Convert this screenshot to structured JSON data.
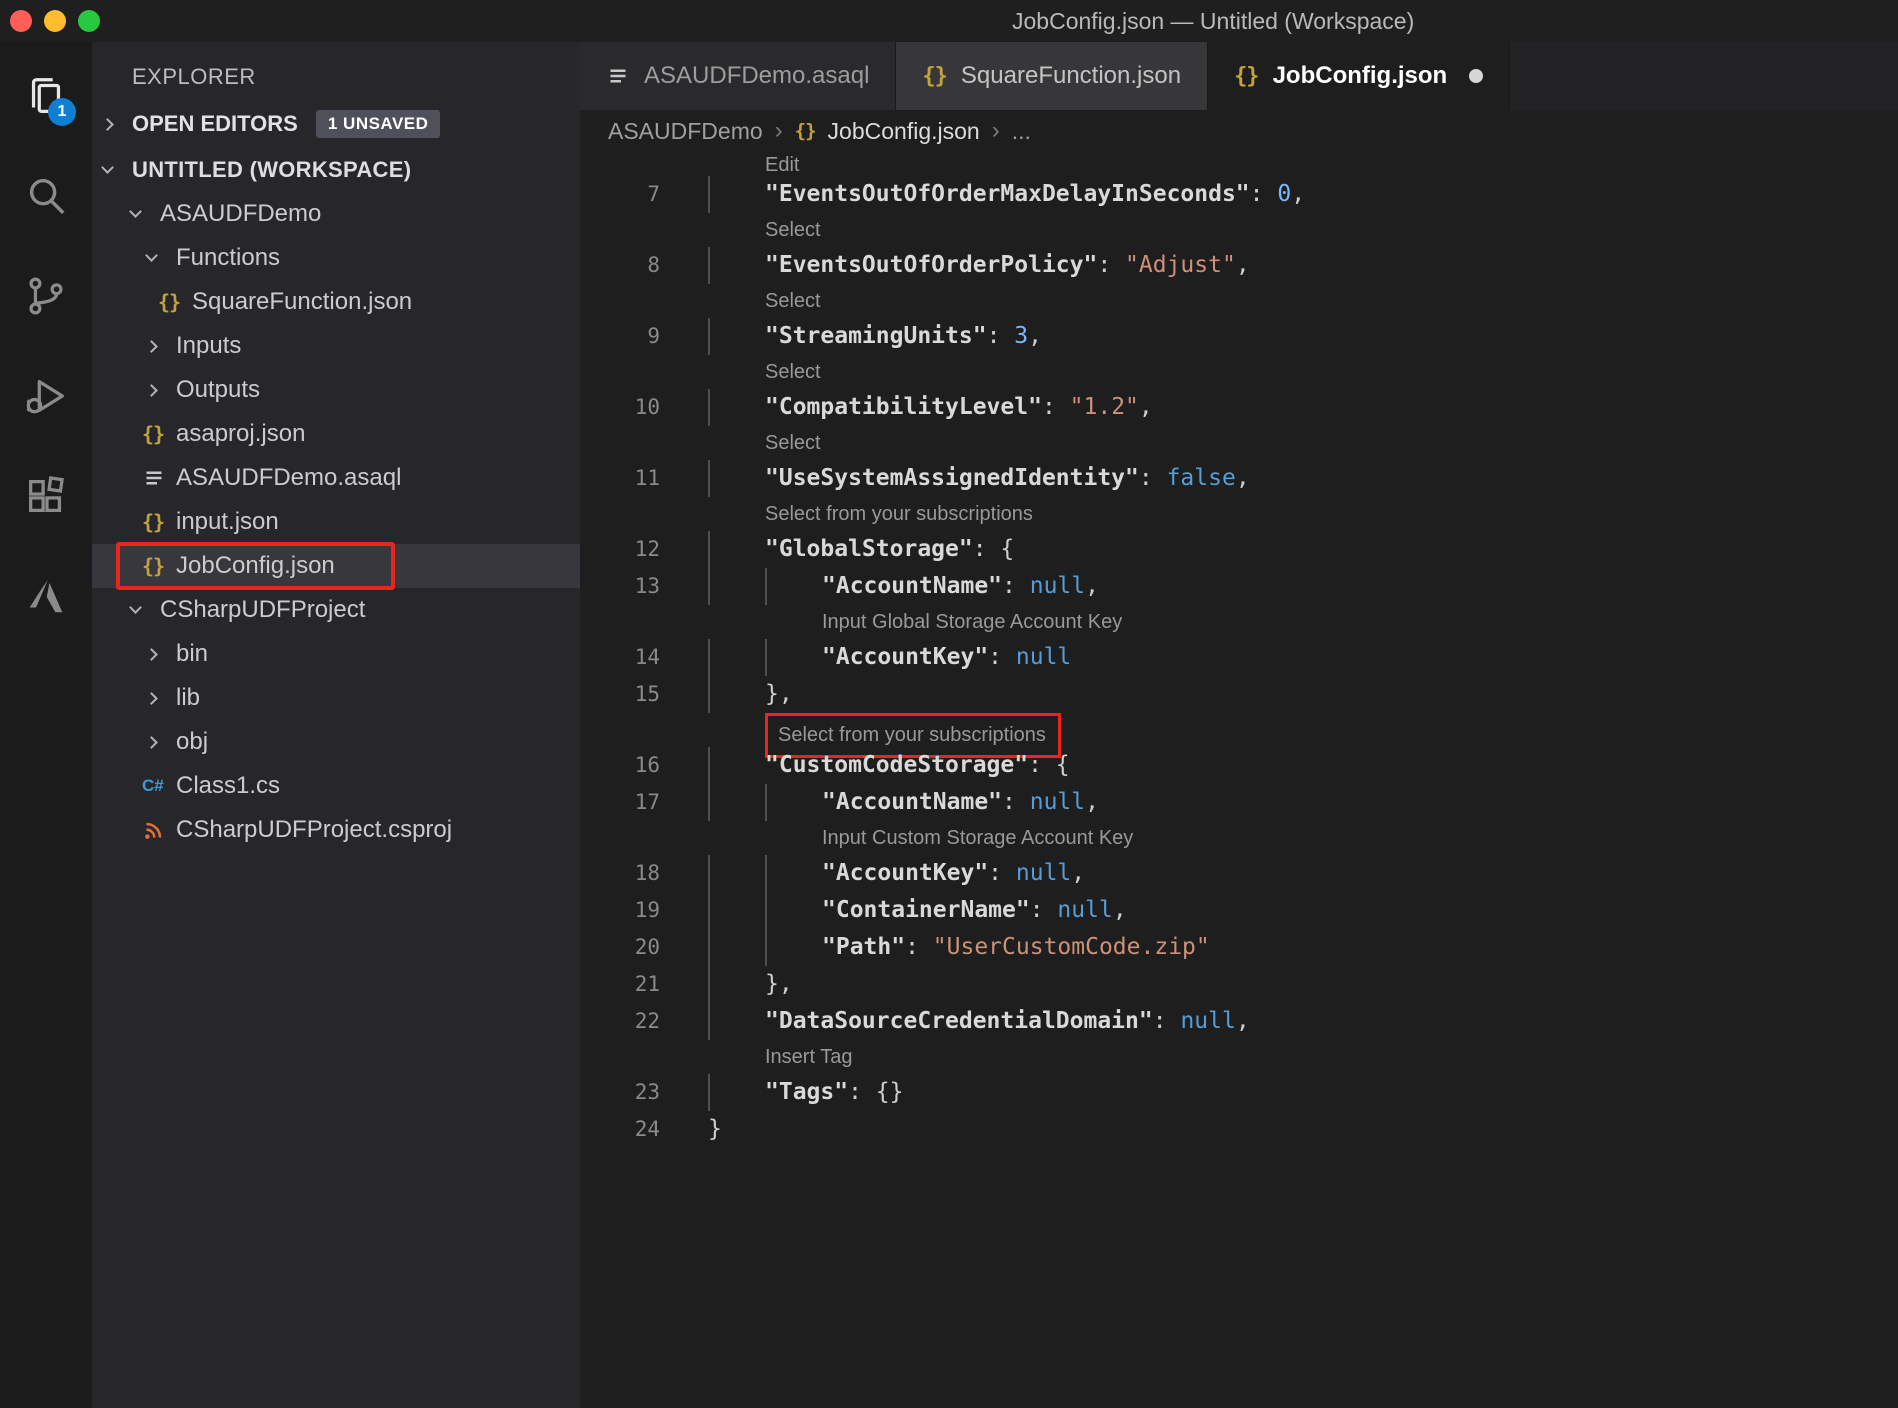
{
  "colors": {
    "annotation_red": "#e8261d",
    "activity_badge_blue": "#0f7fd4",
    "string": "#ce9178",
    "number": "#79b8ff",
    "keyword": "#569cd6",
    "property": "#d9d9d9",
    "codelens": "#999999",
    "selection_bg": "#37373d",
    "json_icon_yellow": "#c2a23c",
    "traffic_red": "#ff5f57",
    "traffic_yellow": "#febc2e",
    "traffic_green": "#28c840"
  },
  "titlebar": {
    "title": "JobConfig.json — Untitled (Workspace)"
  },
  "activity_bar": {
    "items": [
      {
        "name": "explorer",
        "active": true,
        "badge": "1"
      },
      {
        "name": "search"
      },
      {
        "name": "source-control"
      },
      {
        "name": "run-debug"
      },
      {
        "name": "extensions"
      },
      {
        "name": "azure"
      }
    ]
  },
  "sidebar": {
    "header": "EXPLORER",
    "open_editors": {
      "label": "OPEN EDITORS",
      "badge": "1 UNSAVED"
    },
    "tree": [
      {
        "label": "UNTITLED (WORKSPACE)",
        "indent": 0,
        "chevron": "down",
        "bold": true
      },
      {
        "label": "ASAUDFDemo",
        "indent": 1,
        "chevron": "down"
      },
      {
        "label": "Functions",
        "indent": 2,
        "chevron": "down"
      },
      {
        "label": "SquareFunction.json",
        "indent": 3,
        "icon": "json"
      },
      {
        "label": "Inputs",
        "indent": 2,
        "chevron": "right"
      },
      {
        "label": "Outputs",
        "indent": 2,
        "chevron": "right"
      },
      {
        "label": "asaproj.json",
        "indent": 2,
        "icon": "json"
      },
      {
        "label": "ASAUDFDemo.asaql",
        "indent": 2,
        "icon": "asaql"
      },
      {
        "label": "input.json",
        "indent": 2,
        "icon": "json"
      },
      {
        "label": "JobConfig.json",
        "indent": 2,
        "icon": "json",
        "selected": true,
        "annotated": true
      },
      {
        "label": "CSharpUDFProject",
        "indent": 1,
        "chevron": "down"
      },
      {
        "label": "bin",
        "indent": 2,
        "chevron": "right"
      },
      {
        "label": "lib",
        "indent": 2,
        "chevron": "right"
      },
      {
        "label": "obj",
        "indent": 2,
        "chevron": "right"
      },
      {
        "label": "Class1.cs",
        "indent": 2,
        "icon": "csharp"
      },
      {
        "label": "CSharpUDFProject.csproj",
        "indent": 2,
        "icon": "csproj"
      }
    ]
  },
  "tabs": [
    {
      "label": "ASAUDFDemo.asaql",
      "icon": "asaql",
      "active": false,
      "dirty": false
    },
    {
      "label": "SquareFunction.json",
      "icon": "json",
      "active": false,
      "dirty": false
    },
    {
      "label": "JobConfig.json",
      "icon": "json",
      "active": true,
      "dirty": true
    }
  ],
  "breadcrumb": {
    "project": "ASAUDFDemo",
    "file": "JobConfig.json",
    "more": "..."
  },
  "editor": {
    "rows": [
      {
        "type": "codelens",
        "text": "Edit",
        "indent": 1,
        "clipped": true
      },
      {
        "type": "code",
        "num": 7,
        "indent": 1,
        "tokens": [
          [
            "key",
            "\"EventsOutOfOrderMaxDelayInSeconds\""
          ],
          [
            "punct",
            ": "
          ],
          [
            "num",
            "0"
          ],
          [
            "punct",
            ","
          ]
        ]
      },
      {
        "type": "codelens",
        "text": "Select",
        "indent": 1
      },
      {
        "type": "code",
        "num": 8,
        "indent": 1,
        "tokens": [
          [
            "key",
            "\"EventsOutOfOrderPolicy\""
          ],
          [
            "punct",
            ": "
          ],
          [
            "str",
            "\"Adjust\""
          ],
          [
            "punct",
            ","
          ]
        ]
      },
      {
        "type": "codelens",
        "text": "Select",
        "indent": 1
      },
      {
        "type": "code",
        "num": 9,
        "indent": 1,
        "tokens": [
          [
            "key",
            "\"StreamingUnits\""
          ],
          [
            "punct",
            ": "
          ],
          [
            "num",
            "3"
          ],
          [
            "punct",
            ","
          ]
        ]
      },
      {
        "type": "codelens",
        "text": "Select",
        "indent": 1
      },
      {
        "type": "code",
        "num": 10,
        "indent": 1,
        "tokens": [
          [
            "key",
            "\"CompatibilityLevel\""
          ],
          [
            "punct",
            ": "
          ],
          [
            "str",
            "\"1.2\""
          ],
          [
            "punct",
            ","
          ]
        ]
      },
      {
        "type": "codelens",
        "text": "Select",
        "indent": 1
      },
      {
        "type": "code",
        "num": 11,
        "indent": 1,
        "tokens": [
          [
            "key",
            "\"UseSystemAssignedIdentity\""
          ],
          [
            "punct",
            ": "
          ],
          [
            "kw",
            "false"
          ],
          [
            "punct",
            ","
          ]
        ]
      },
      {
        "type": "codelens",
        "text": "Select from your subscriptions",
        "indent": 1
      },
      {
        "type": "code",
        "num": 12,
        "indent": 1,
        "tokens": [
          [
            "key",
            "\"GlobalStorage\""
          ],
          [
            "punct",
            ": {"
          ]
        ]
      },
      {
        "type": "code",
        "num": 13,
        "indent": 2,
        "tokens": [
          [
            "key",
            "\"AccountName\""
          ],
          [
            "punct",
            ": "
          ],
          [
            "kw",
            "null"
          ],
          [
            "punct",
            ","
          ]
        ]
      },
      {
        "type": "codelens",
        "text": "Input Global Storage Account Key",
        "indent": 2
      },
      {
        "type": "code",
        "num": 14,
        "indent": 2,
        "tokens": [
          [
            "key",
            "\"AccountKey\""
          ],
          [
            "punct",
            ": "
          ],
          [
            "kw",
            "null"
          ]
        ]
      },
      {
        "type": "code",
        "num": 15,
        "indent": 1,
        "tokens": [
          [
            "punct",
            "},"
          ]
        ]
      },
      {
        "type": "codelens",
        "text": "Select from your subscriptions",
        "indent": 1,
        "annotated": true
      },
      {
        "type": "code",
        "num": 16,
        "indent": 1,
        "tokens": [
          [
            "key",
            "\"CustomCodeStorage\""
          ],
          [
            "punct",
            ": {"
          ]
        ]
      },
      {
        "type": "code",
        "num": 17,
        "indent": 2,
        "tokens": [
          [
            "key",
            "\"AccountName\""
          ],
          [
            "punct",
            ": "
          ],
          [
            "kw",
            "null"
          ],
          [
            "punct",
            ","
          ]
        ]
      },
      {
        "type": "codelens",
        "text": "Input Custom Storage Account Key",
        "indent": 2
      },
      {
        "type": "code",
        "num": 18,
        "indent": 2,
        "tokens": [
          [
            "key",
            "\"AccountKey\""
          ],
          [
            "punct",
            ": "
          ],
          [
            "kw",
            "null"
          ],
          [
            "punct",
            ","
          ]
        ]
      },
      {
        "type": "code",
        "num": 19,
        "indent": 2,
        "tokens": [
          [
            "key",
            "\"ContainerName\""
          ],
          [
            "punct",
            ": "
          ],
          [
            "kw",
            "null"
          ],
          [
            "punct",
            ","
          ]
        ]
      },
      {
        "type": "code",
        "num": 20,
        "indent": 2,
        "tokens": [
          [
            "key",
            "\"Path\""
          ],
          [
            "punct",
            ": "
          ],
          [
            "str",
            "\"UserCustomCode.zip\""
          ]
        ]
      },
      {
        "type": "code",
        "num": 21,
        "indent": 1,
        "tokens": [
          [
            "punct",
            "},"
          ]
        ]
      },
      {
        "type": "code",
        "num": 22,
        "indent": 1,
        "tokens": [
          [
            "key",
            "\"DataSourceCredentialDomain\""
          ],
          [
            "punct",
            ": "
          ],
          [
            "kw",
            "null"
          ],
          [
            "punct",
            ","
          ]
        ]
      },
      {
        "type": "codelens",
        "text": "Insert Tag",
        "indent": 1
      },
      {
        "type": "code",
        "num": 23,
        "indent": 1,
        "tokens": [
          [
            "key",
            "\"Tags\""
          ],
          [
            "punct",
            ": {}"
          ]
        ]
      },
      {
        "type": "code",
        "num": 24,
        "indent": 0,
        "tokens": [
          [
            "punct",
            "}"
          ]
        ]
      }
    ]
  }
}
